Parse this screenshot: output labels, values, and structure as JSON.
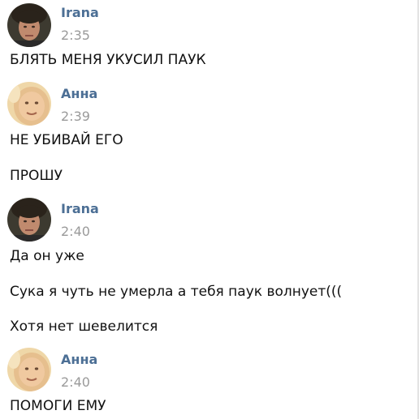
{
  "messages": [
    {
      "author": "Irana",
      "avatar": "photo-irana",
      "time": "2:35",
      "lines": [
        "БЛЯТЬ МЕНЯ УКУСИЛ ПАУК"
      ]
    },
    {
      "author": "Анна",
      "avatar": "photo-anna",
      "time": "2:39",
      "lines": [
        "НЕ УБИВАЙ ЕГО",
        "ПРОШУ"
      ]
    },
    {
      "author": "Irana",
      "avatar": "photo-irana",
      "time": "2:40",
      "lines": [
        "Да он уже",
        "Сука я чуть не умерла а тебя паук волнует(((",
        "Хотя нет шевелится"
      ]
    },
    {
      "author": "Анна",
      "avatar": "photo-anna",
      "time": "2:40",
      "lines": [
        "ПОМОГИ ЕМУ"
      ]
    }
  ],
  "colors": {
    "author_name": "#4c6f95",
    "timestamp": "#9a9a9a",
    "message_text": "#111111"
  }
}
